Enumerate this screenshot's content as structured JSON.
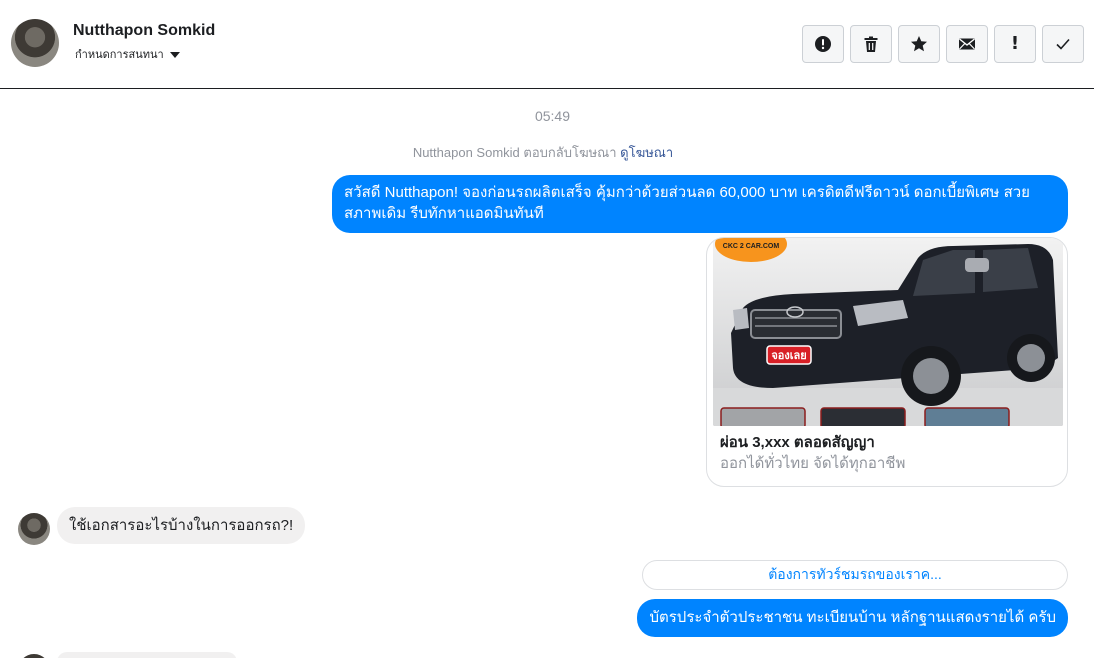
{
  "header": {
    "contact_name": "Nutthapon Somkid",
    "conversation_settings": "กำหนดการสนทนา",
    "actions": [
      {
        "name": "report-button",
        "icon": "alert-circle-icon"
      },
      {
        "name": "delete-button",
        "icon": "trash-icon"
      },
      {
        "name": "star-button",
        "icon": "star-icon"
      },
      {
        "name": "mark-unread-button",
        "icon": "envelope-icon"
      },
      {
        "name": "mark-spam-button",
        "icon": "exclamation-icon",
        "glyph": "!"
      },
      {
        "name": "mark-done-button",
        "icon": "check-icon"
      }
    ]
  },
  "thread": {
    "timestamp": "05:49",
    "ad_reply_text": "Nutthapon Somkid ตอบกลับโฆษณา",
    "ad_reply_link": "ดูโฆษณา",
    "messages": [
      {
        "from": "page",
        "text": "สวัสดี Nutthapon! จองก่อนรถผลิตเสร็จ คุ้มกว่าด้วยส่วนลด 60,000 บาท เครดิตดีฟรีดาวน์ ดอกเบี้ยพิเศษ สวยสภาพเดิม รีบทักหาแอดมินทันที"
      },
      {
        "from": "user",
        "text": "ใช้เอกสารอะไรบ้างในการออกรถ?!"
      },
      {
        "from": "page",
        "text": "บัตรประจำตัวประชาชน ทะเบียนบ้าน หลักฐานแสดงรายได้ ครับ"
      }
    ],
    "ad_card": {
      "title": "ผ่อน 3,xxx ตลอดสัญญา",
      "subtitle": "ออกได้ทั่วไทย จัดได้ทุกอาชีพ",
      "logo_text": "CKC 2 CAR.COM",
      "badge_text": "จองเลย"
    },
    "quick_reply": "ต้องการทัวร์ชมรถของเราค..."
  },
  "colors": {
    "accent": "#0084ff",
    "incoming_bubble": "#f1f0f0",
    "muted_text": "#90949c",
    "link": "#385898"
  }
}
